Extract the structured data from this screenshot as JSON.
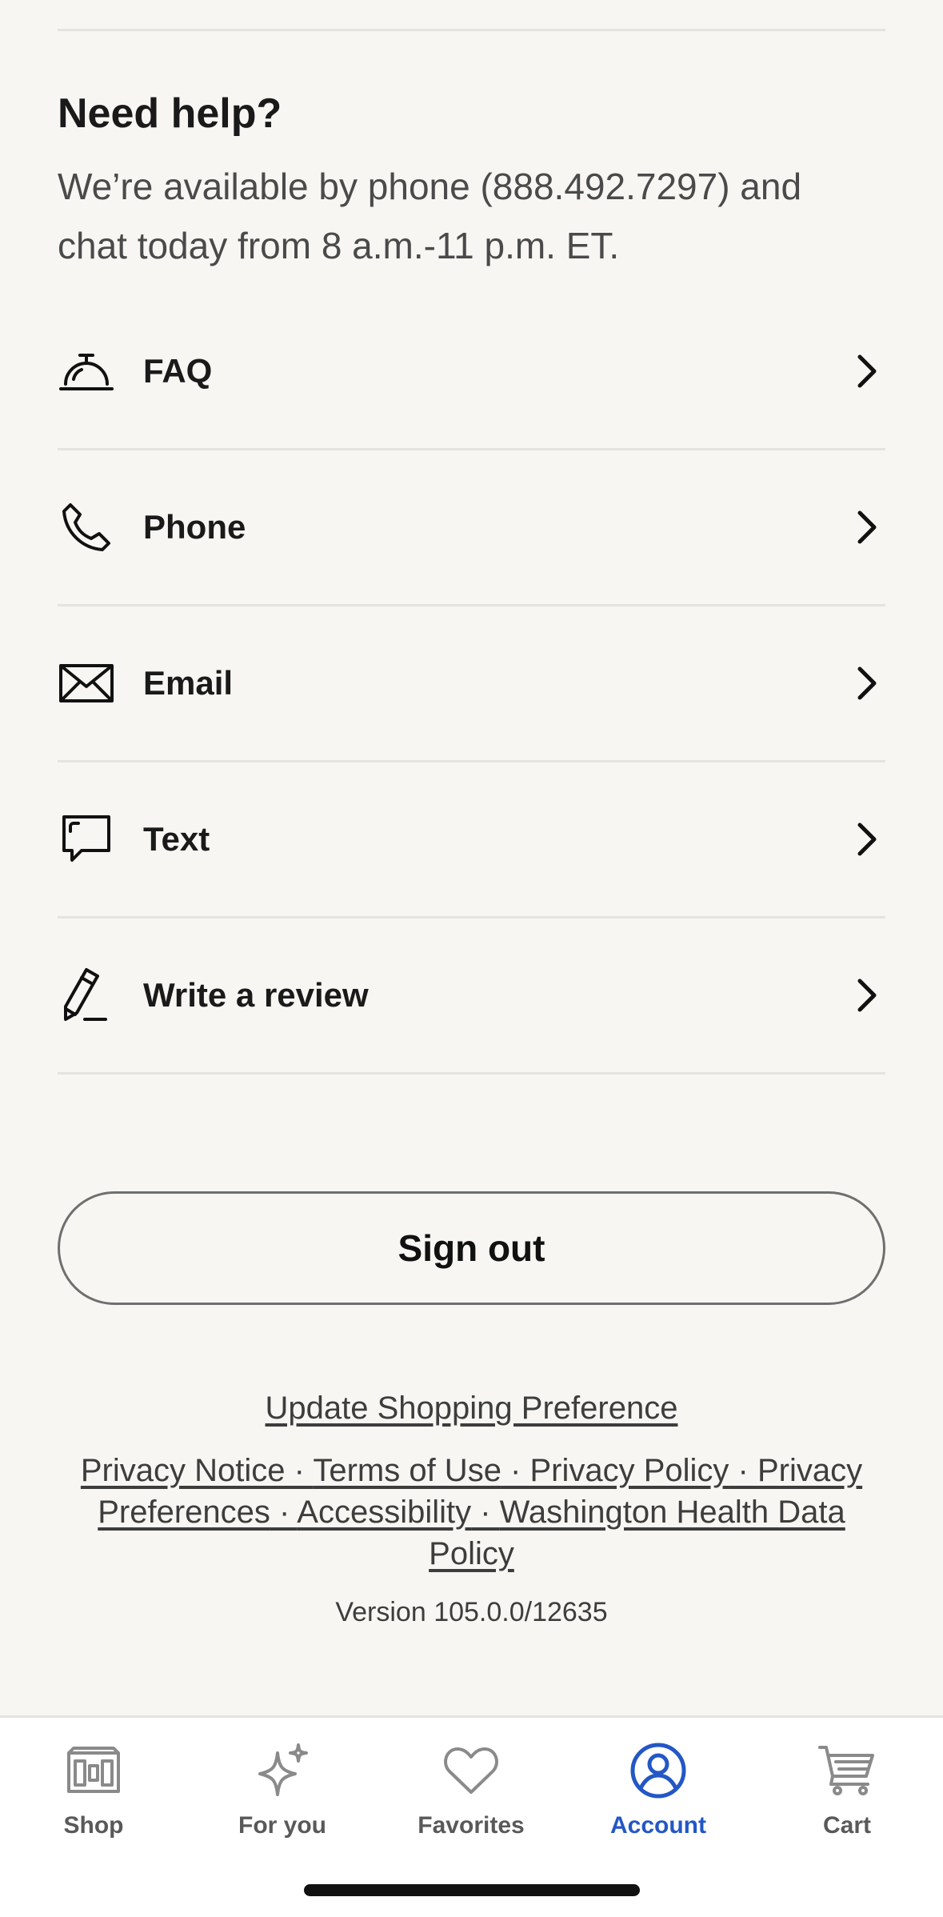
{
  "help": {
    "title": "Need help?",
    "description": "We’re available by phone (888.492.7297) and chat today from 8 a.m.-11 p.m. ET."
  },
  "menu": [
    {
      "label": "FAQ",
      "icon": "service-bell-icon"
    },
    {
      "label": "Phone",
      "icon": "phone-icon"
    },
    {
      "label": "Email",
      "icon": "envelope-icon"
    },
    {
      "label": "Text",
      "icon": "chat-bubble-icon"
    },
    {
      "label": "Write a review",
      "icon": "pencil-icon"
    }
  ],
  "sign_out": "Sign out",
  "footer": {
    "shopping_preference": "Update Shopping Preference",
    "links": [
      "Privacy Notice",
      "Terms of Use",
      "Privacy Policy",
      "Privacy Preferences",
      "Accessibility",
      "Washington Health Data Policy"
    ],
    "separator": " · ",
    "version": "Version 105.0.0/12635"
  },
  "tabs": [
    {
      "label": "Shop",
      "icon": "shop-icon",
      "active": false
    },
    {
      "label": "For you",
      "icon": "sparkle-icon",
      "active": false
    },
    {
      "label": "Favorites",
      "icon": "heart-icon",
      "active": false
    },
    {
      "label": "Account",
      "icon": "account-icon",
      "active": true
    },
    {
      "label": "Cart",
      "icon": "cart-icon",
      "active": false
    }
  ],
  "colors": {
    "background": "#f7f6f3",
    "accent": "#2457c5",
    "text": "#1a1a1a",
    "muted": "#595959"
  }
}
